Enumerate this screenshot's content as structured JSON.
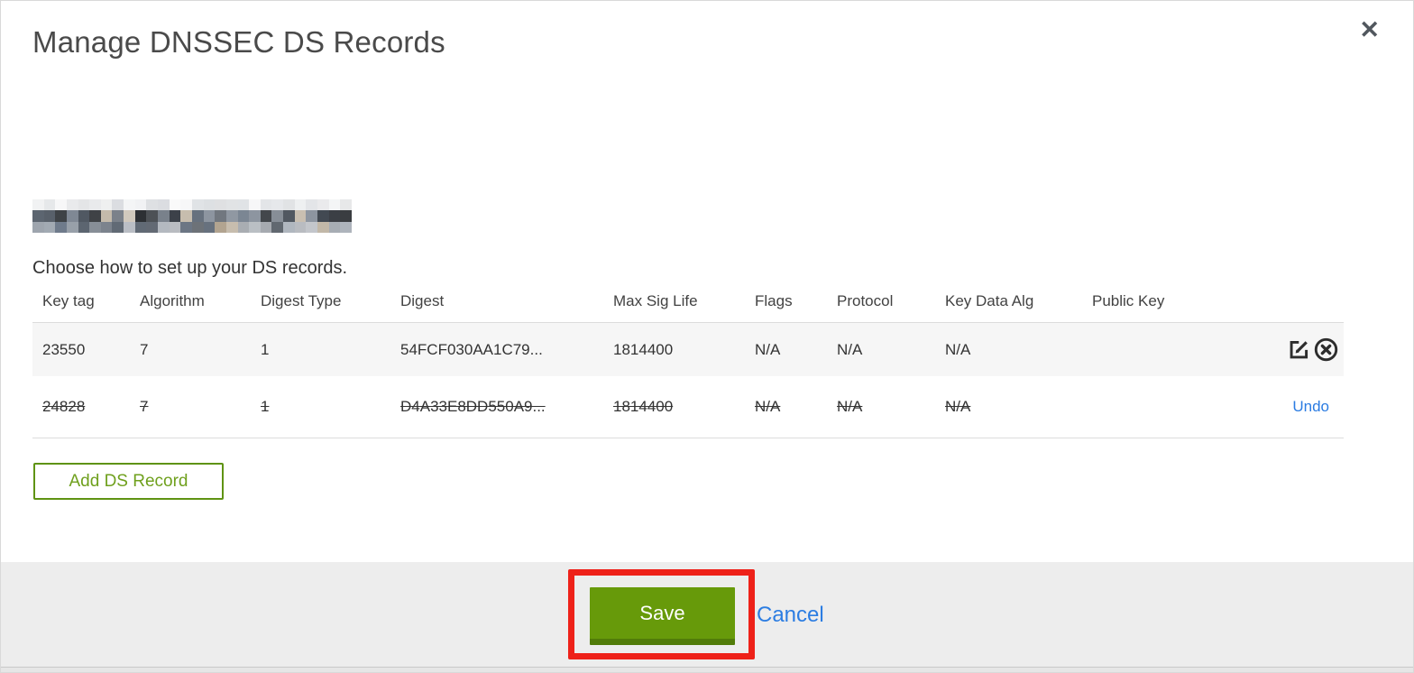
{
  "modal": {
    "title": "Manage DNSSEC DS Records",
    "intro": "Choose how to set up your DS records.",
    "domain": {
      "redacted": true
    }
  },
  "icons": {
    "close": "✕"
  },
  "table": {
    "columns": [
      "Key tag",
      "Algorithm",
      "Digest Type",
      "Digest",
      "Max Sig Life",
      "Flags",
      "Protocol",
      "Key Data Alg",
      "Public Key"
    ],
    "rows": [
      {
        "key_tag": "23550",
        "algorithm": "7",
        "digest_type": "1",
        "digest": "54FCF030AA1C79...",
        "max_sig_life": "1814400",
        "flags": "N/A",
        "protocol": "N/A",
        "key_data_alg": "N/A",
        "public_key": "",
        "state": "normal",
        "actions": [
          "edit",
          "delete"
        ]
      },
      {
        "key_tag": "24828",
        "algorithm": "7",
        "digest_type": "1",
        "digest": "D4A33E8DD550A9...",
        "max_sig_life": "1814400",
        "flags": "N/A",
        "protocol": "N/A",
        "key_data_alg": "N/A",
        "public_key": "",
        "state": "deleted",
        "action_label": "Undo"
      }
    ]
  },
  "buttons": {
    "add_ds_record": "Add DS Record",
    "save": "Save",
    "cancel": "Cancel"
  },
  "colors": {
    "accent_green": "#679a0a",
    "accent_green_dark": "#517c09",
    "outline_green": "#5f9313",
    "link_blue": "#2b7ce2",
    "annotation_red": "#ee2119",
    "footer_gray": "#ededed",
    "row_stripe": "#f6f6f6"
  }
}
